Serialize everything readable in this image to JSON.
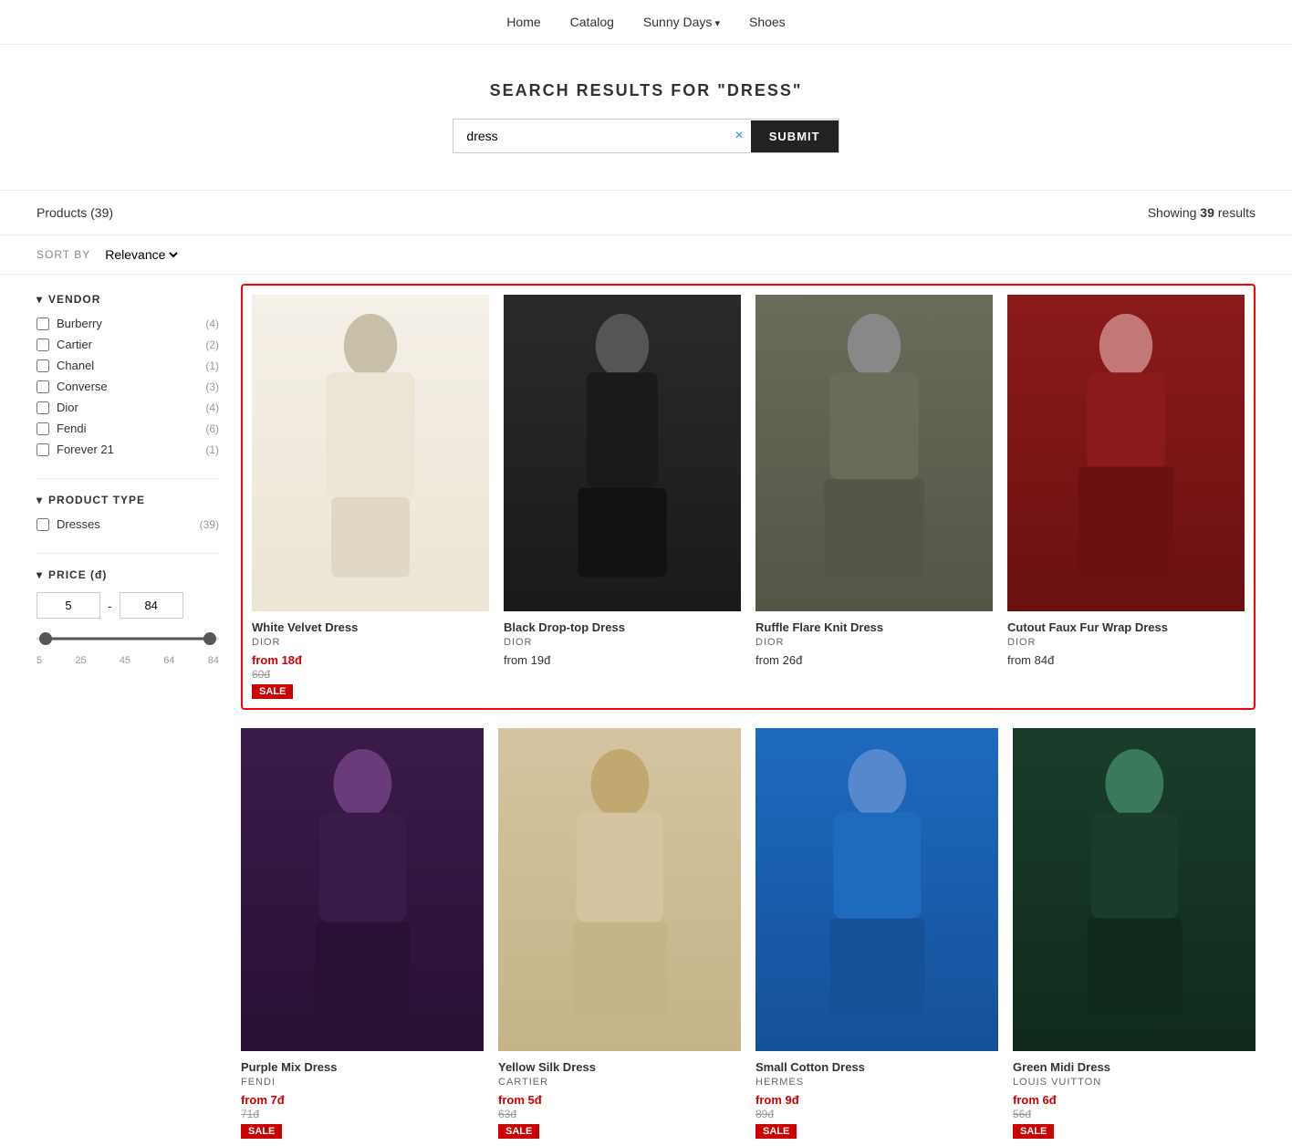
{
  "nav": {
    "items": [
      {
        "label": "Home",
        "hasArrow": false
      },
      {
        "label": "Catalog",
        "hasArrow": false
      },
      {
        "label": "Sunny Days",
        "hasArrow": true
      },
      {
        "label": "Shoes",
        "hasArrow": false
      }
    ]
  },
  "search": {
    "title": "SEARCH RESULTS FOR \"DRESS\"",
    "query": "dress",
    "placeholder": "dress",
    "clear_label": "×",
    "submit_label": "SUBMIT"
  },
  "results": {
    "products_label": "Products (39)",
    "showing_prefix": "Showing",
    "showing_count": "39",
    "showing_suffix": "results"
  },
  "sort": {
    "label": "SORT BY",
    "selected": "Relevance"
  },
  "sidebar": {
    "vendor_title": "VENDOR",
    "vendor_arrow": "▾",
    "vendors": [
      {
        "name": "Burberry",
        "count": 4
      },
      {
        "name": "Cartier",
        "count": 2
      },
      {
        "name": "Chanel",
        "count": 1
      },
      {
        "name": "Converse",
        "count": 3
      },
      {
        "name": "Dior",
        "count": 4
      },
      {
        "name": "Fendi",
        "count": 6
      },
      {
        "name": "Forever 21",
        "count": 1
      }
    ],
    "product_type_title": "PRODUCT TYPE",
    "product_type_arrow": "▾",
    "product_types": [
      {
        "name": "Dresses",
        "count": 39
      }
    ],
    "price_title": "PRICE (đ)",
    "price_arrow": "▾",
    "price_min": "5",
    "price_max": "84",
    "price_ticks": [
      "5",
      "25",
      "45",
      "64",
      "84"
    ]
  },
  "highlighted_products": [
    {
      "name": "White Velvet Dress",
      "vendor": "DIOR",
      "sale_price": "from 18đ",
      "original_price": "60đ",
      "is_sale": true,
      "img_class": "img-white-dress"
    },
    {
      "name": "Black Drop-top Dress",
      "vendor": "DIOR",
      "price": "from 19đ",
      "is_sale": false,
      "img_class": "img-black-dress"
    },
    {
      "name": "Ruffle Flare Knit Dress",
      "vendor": "DIOR",
      "price": "from 26đ",
      "is_sale": false,
      "img_class": "img-knit-dress"
    },
    {
      "name": "Cutout Faux Fur Wrap Dress",
      "vendor": "DIOR",
      "price": "from 84đ",
      "is_sale": false,
      "img_class": "img-red-dress"
    }
  ],
  "regular_products": [
    {
      "name": "Purple Mix Dress",
      "vendor": "FENDI",
      "sale_price": "from 7đ",
      "original_price": "71đ",
      "is_sale": true,
      "img_class": "img-purple-dress"
    },
    {
      "name": "Yellow Silk Dress",
      "vendor": "CARTIER",
      "sale_price": "from 5đ",
      "original_price": "63đ",
      "is_sale": true,
      "img_class": "img-yellow-dress"
    },
    {
      "name": "Small Cotton Dress",
      "vendor": "HERMES",
      "sale_price": "from 9đ",
      "original_price": "89đ",
      "is_sale": true,
      "img_class": "img-blue-dress"
    },
    {
      "name": "Green Midi Dress",
      "vendor": "LOUIS VUITTON",
      "sale_price": "from 6đ",
      "original_price": "56đ",
      "is_sale": true,
      "img_class": "img-green-dress"
    }
  ]
}
